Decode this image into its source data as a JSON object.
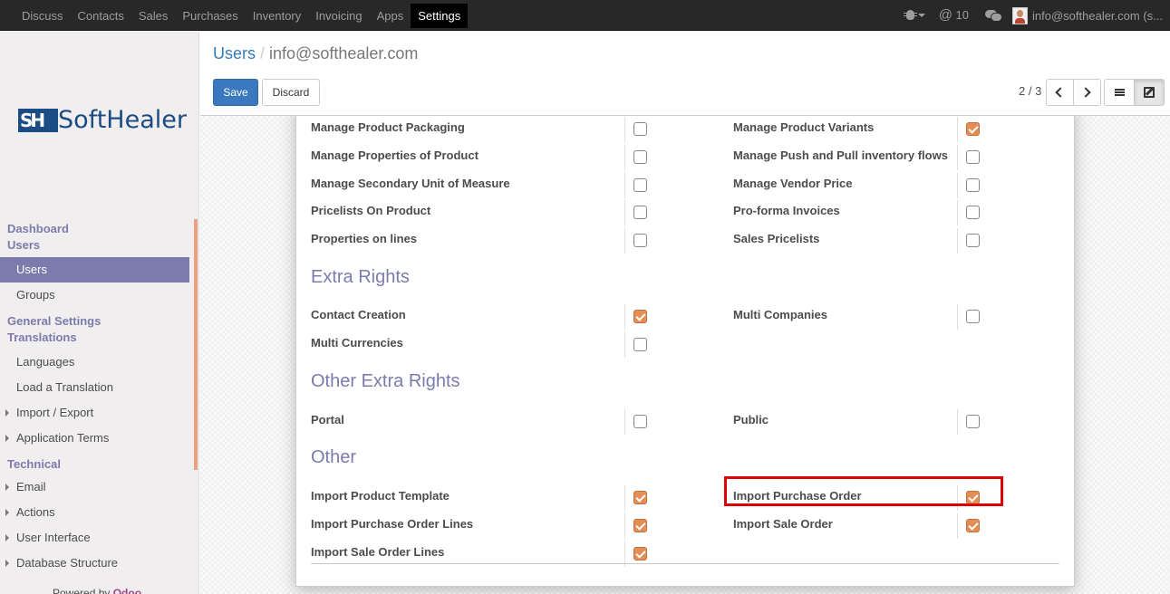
{
  "topnav": {
    "menu": [
      "Discuss",
      "Contacts",
      "Sales",
      "Purchases",
      "Inventory",
      "Invoicing",
      "Apps",
      "Settings"
    ],
    "active": "Settings",
    "mentions": "10",
    "user": "info@softhealer.com (s..."
  },
  "sidebar": {
    "logo_mark": "SH",
    "logo_text": "SoftHealer",
    "sections": [
      {
        "title": "Dashboard"
      },
      {
        "title": "Users",
        "items": [
          {
            "label": "Users",
            "active": true
          },
          {
            "label": "Groups"
          }
        ]
      },
      {
        "title": "General Settings"
      },
      {
        "title": "Translations",
        "items": [
          {
            "label": "Languages"
          },
          {
            "label": "Load a Translation"
          },
          {
            "label": "Import / Export",
            "arrow": true
          },
          {
            "label": "Application Terms",
            "arrow": true
          }
        ]
      },
      {
        "title": "Technical",
        "items": [
          {
            "label": "Email",
            "arrow": true
          },
          {
            "label": "Actions",
            "arrow": true
          },
          {
            "label": "User Interface",
            "arrow": true
          },
          {
            "label": "Database Structure",
            "arrow": true
          }
        ]
      }
    ],
    "powered_by": "Powered by",
    "powered_brand": "Odoo"
  },
  "control": {
    "breadcrumb_root": "Users",
    "breadcrumb_sep": "/",
    "breadcrumb_current": "info@softhealer.com",
    "save_label": "Save",
    "discard_label": "Discard",
    "pager": "2 / 3"
  },
  "form": {
    "top_rows": [
      {
        "left": "Manage Product Packaging",
        "left_checked": false,
        "right": "Manage Product Variants",
        "right_checked": true
      },
      {
        "left": "Manage Properties of Product",
        "left_checked": false,
        "right": "Manage Push and Pull inventory flows",
        "right_checked": false
      },
      {
        "left": "Manage Secondary Unit of Measure",
        "left_checked": false,
        "right": "Manage Vendor Price",
        "right_checked": false
      },
      {
        "left": "Pricelists On Product",
        "left_checked": false,
        "right": "Pro-forma Invoices",
        "right_checked": false
      },
      {
        "left": "Properties on lines",
        "left_checked": false,
        "right": "Sales Pricelists",
        "right_checked": false
      }
    ],
    "extra_rights_title": "Extra Rights",
    "extra_rows": [
      {
        "left": "Contact Creation",
        "left_checked": true,
        "right": "Multi Companies",
        "right_checked": false
      },
      {
        "left": "Multi Currencies",
        "left_checked": false
      }
    ],
    "other_extra_title": "Other Extra Rights",
    "other_extra_rows": [
      {
        "left": "Portal",
        "left_checked": false,
        "right": "Public",
        "right_checked": false
      }
    ],
    "other_title": "Other",
    "other_rows": [
      {
        "left": "Import Product Template",
        "left_checked": true,
        "right": "Import Purchase Order",
        "right_checked": true
      },
      {
        "left": "Import Purchase Order Lines",
        "left_checked": true,
        "right": "Import Sale Order",
        "right_checked": true
      },
      {
        "left": "Import Sale Order Lines",
        "left_checked": true
      }
    ]
  },
  "colors": {
    "accent": "#7c7bad",
    "checkbox": "#e48e56",
    "highlight": "#e00000",
    "primary": "#3a79bf"
  }
}
